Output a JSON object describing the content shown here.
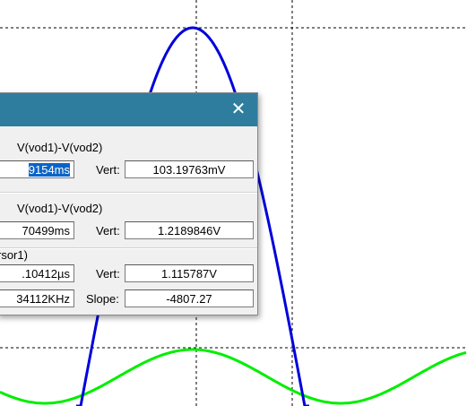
{
  "colors": {
    "trace1": "#0000dd",
    "trace2": "#00ee00",
    "grid": "#000000",
    "titlebar": "#2e7d9e"
  },
  "dialog": {
    "close_icon": "close-icon",
    "cursor1": {
      "trace_name": "V(vod1)-V(vod2)",
      "horz_value": "9154ms",
      "vert_label": "Vert:",
      "vert_value": "103.19763mV"
    },
    "cursor2": {
      "trace_name": "V(vod1)-V(vod2)",
      "horz_value": "70499ms",
      "vert_label": "Vert:",
      "vert_value": "1.2189846V"
    },
    "diff": {
      "header": "rsor1)",
      "horz_value": ".10412µs",
      "vert_label": "Vert:",
      "vert_value": "1.115787V",
      "freq_value": "34112KHz",
      "slope_label": "Slope:",
      "slope_value": "-4807.27"
    }
  }
}
